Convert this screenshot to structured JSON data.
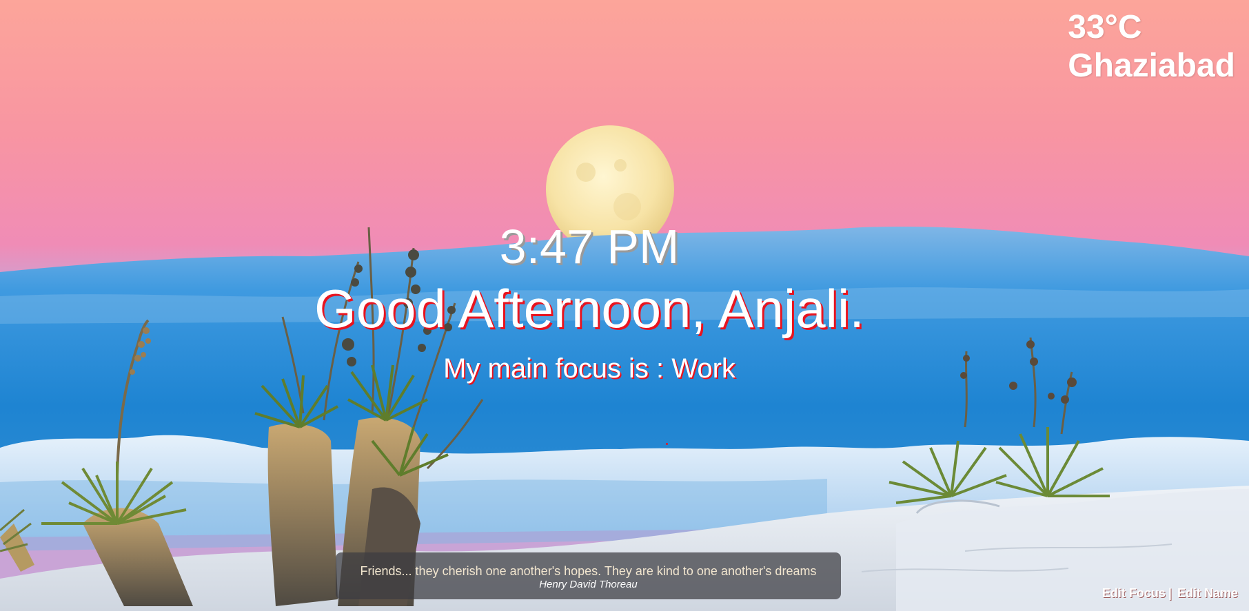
{
  "weather": {
    "temperature": "33°C",
    "city": "Ghaziabad"
  },
  "clock": {
    "time": "3:47 PM"
  },
  "greeting": {
    "text": "Good Afternoon, Anjali."
  },
  "focus": {
    "text": "My main focus is : Work"
  },
  "quote": {
    "text": "Friends... they cherish one another's hopes. They are kind to one another's dreams",
    "author": "Henry David Thoreau"
  },
  "links": {
    "edit_focus": "Edit Focus",
    "separator": "|",
    "edit_name": "Edit Name"
  },
  "colors": {
    "greeting_shadow": "#e8141f",
    "clock_shadow": "#9a9a9a",
    "sky_top": "#fca59a",
    "sky_mid": "#f38fb0",
    "cloud_blue": "#2b8fd6"
  },
  "icons": {
    "background": "desert-moonrise-landscape"
  }
}
